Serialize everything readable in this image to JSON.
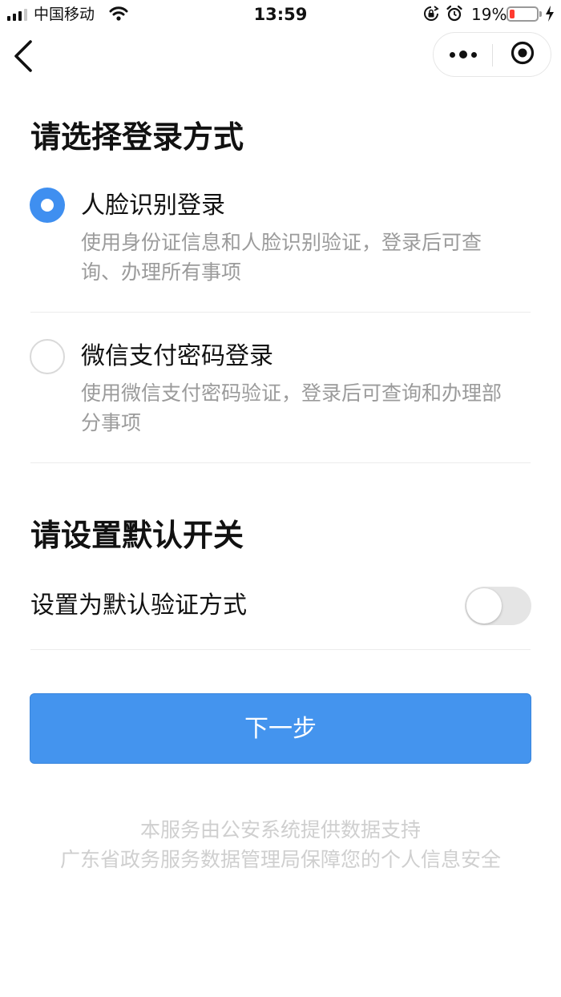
{
  "status_bar": {
    "carrier": "中国移动",
    "time": "13:59",
    "battery": "19%",
    "battery_level": 0.19,
    "battery_color": "#ff3b30",
    "icons": [
      "signal-icon",
      "wifi-icon",
      "orientation-lock-icon",
      "alarm-icon",
      "battery-icon",
      "charging-icon"
    ]
  },
  "nav": {
    "back_icon": "chevron-left-icon",
    "more_icon": "more-dots-icon",
    "close_icon": "miniprogram-close-icon"
  },
  "login": {
    "title": "请选择登录方式",
    "options": [
      {
        "label": "人脸识别登录",
        "description": "使用身份证信息和人脸识别验证，登录后可查询、办理所有事项",
        "selected": true
      },
      {
        "label": "微信支付密码登录",
        "description": "使用微信支付密码验证，登录后可查询和办理部分事项",
        "selected": false
      }
    ]
  },
  "default_switch": {
    "title": "请设置默认开关",
    "label": "设置为默认验证方式",
    "enabled": false
  },
  "next_button": "下一步",
  "footer": {
    "line1": "本服务由公安系统提供数据支持",
    "line2": "广东省政务服务数据管理局保障您的个人信息安全"
  },
  "colors": {
    "accent": "#4494ee",
    "radio_selected": "#3f8ff0",
    "secondary_text": "#9b9b9b",
    "footer_text": "#cfcfcf"
  }
}
